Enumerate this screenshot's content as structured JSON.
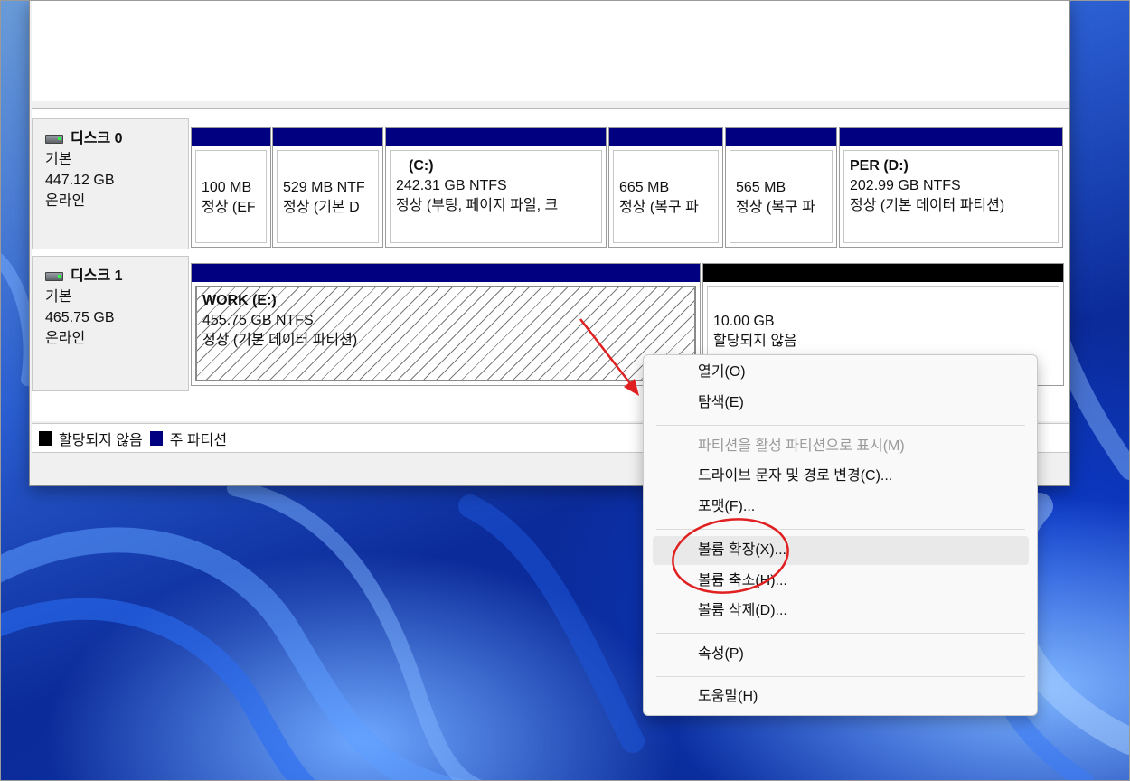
{
  "disks": [
    {
      "name": "디스크 0",
      "type": "기본",
      "size": "447.12 GB",
      "status": "온라인",
      "partitions": [
        {
          "title": "",
          "size": "100 MB",
          "status": "정상 (EF"
        },
        {
          "title": "",
          "size": "529 MB NTF",
          "status": "정상 (기본 D"
        },
        {
          "title": "(C:)",
          "size": "242.31 GB NTFS",
          "status": "정상 (부팅, 페이지 파일, 크"
        },
        {
          "title": "",
          "size": "665 MB",
          "status": "정상 (복구 파"
        },
        {
          "title": "",
          "size": "565 MB",
          "status": "정상 (복구 파"
        },
        {
          "title": "PER  (D:)",
          "size": "202.99 GB NTFS",
          "status": "정상 (기본 데이터 파티션)"
        }
      ]
    },
    {
      "name": "디스크 1",
      "type": "기본",
      "size": "465.75 GB",
      "status": "온라인",
      "partitions": [
        {
          "title": "WORK  (E:)",
          "size": "455.75 GB NTFS",
          "status": "정상 (기본 데이터 파티션)"
        },
        {
          "title": "",
          "size": "10.00 GB",
          "status": "할당되지 않음"
        }
      ]
    }
  ],
  "legend": {
    "unallocated": "할당되지 않음",
    "primary": "주 파티션"
  },
  "context_menu": {
    "open": "열기(O)",
    "explore": "탐색(E)",
    "mark_active": "파티션을 활성 파티션으로 표시(M)",
    "change_letter": "드라이브 문자 및 경로 변경(C)...",
    "format": "포맷(F)...",
    "extend": "볼륨 확장(X)...",
    "shrink": "볼륨 축소(H)...",
    "delete": "볼륨 삭제(D)...",
    "properties": "속성(P)",
    "help": "도움말(H)"
  },
  "colors": {
    "primary_partition": "#000080",
    "unallocated": "#000000",
    "annotation": "#e02020"
  }
}
